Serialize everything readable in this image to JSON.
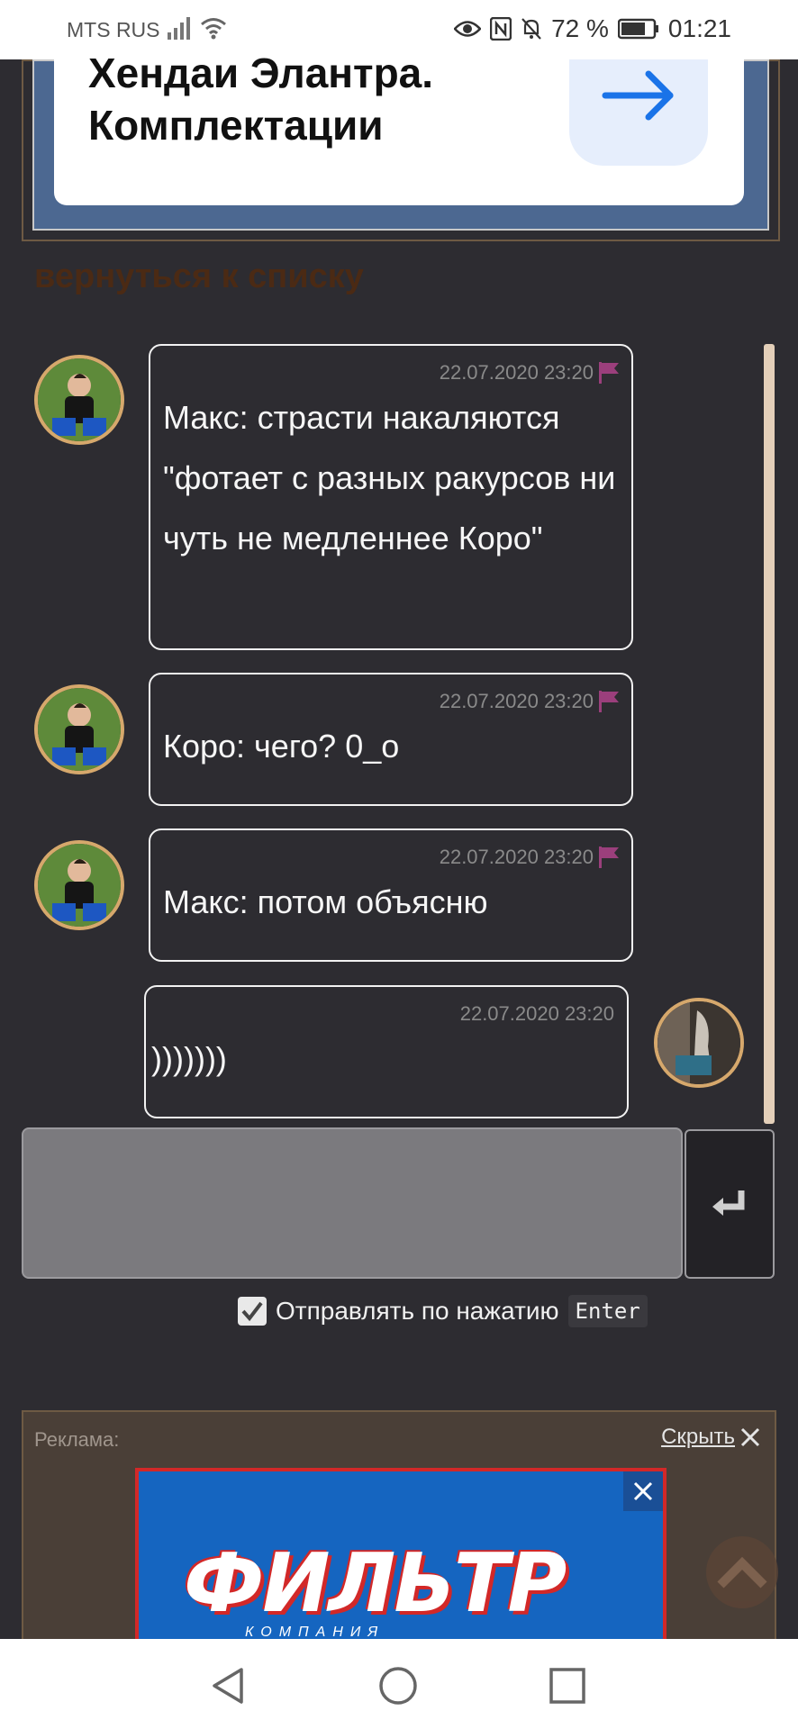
{
  "status_bar": {
    "carrier": "MTS RUS",
    "battery": "72 %",
    "time": "01:21"
  },
  "top_ad": {
    "title_line1": "Хендаи Элантра.",
    "title_line2": "Комплектации"
  },
  "back_link": "вернуться к списку",
  "messages": [
    {
      "time": "22.07.2020 23:20",
      "text": "Макс: страсти накаляются \"фотает с разных ракурсов ни чуть не медленнее Коро\"",
      "side": "left",
      "flag": true
    },
    {
      "time": "22.07.2020 23:20",
      "text": "Коро: чего? 0_о",
      "side": "left",
      "flag": true
    },
    {
      "time": "22.07.2020 23:20",
      "text": "Макс: потом объясню",
      "side": "left",
      "flag": true
    },
    {
      "time": "22.07.2020 23:20",
      "text": ")))))))",
      "side": "right",
      "flag": false
    }
  ],
  "composer": {
    "input_value": "",
    "send_on_enter_label": "Отправлять по нажатию",
    "enter_key": "Enter",
    "send_on_enter_checked": true
  },
  "bottom_ad": {
    "label": "Реклама:",
    "hide_label": "Скрыть",
    "brand": "ФИЛЬТР",
    "brand_sub": "КОМПАНИЯ"
  },
  "colors": {
    "background": "#2d2c31",
    "avatar_border": "#d6a86c",
    "flag": "#9b3f7c",
    "back_link": "#4b2a14"
  }
}
